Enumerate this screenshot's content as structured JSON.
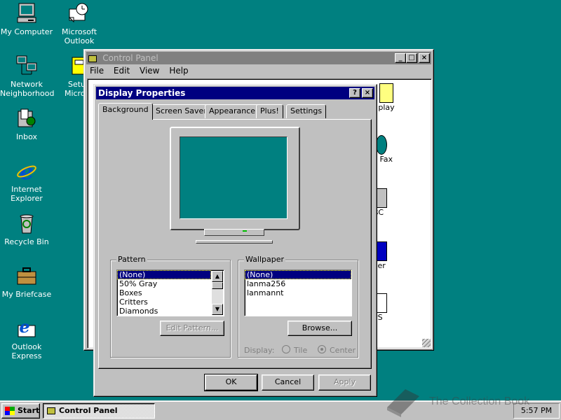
{
  "desktop": {
    "icons": [
      {
        "label": "My Computer"
      },
      {
        "label": "Microsoft\nOutlook"
      },
      {
        "label": "Network\nNeighborhood"
      },
      {
        "label": "Setup\nMicroso"
      },
      {
        "label": "Inbox"
      },
      {
        "label": "Internet\nExplorer"
      },
      {
        "label": "Recycle Bin"
      },
      {
        "label": "My Briefcase"
      },
      {
        "label": "Outlook\nExpress"
      }
    ]
  },
  "control_panel": {
    "title": "Control Panel",
    "menu": [
      "File",
      "Edit",
      "View",
      "Help"
    ],
    "partial_items": [
      "play",
      "nd Fax",
      "BC",
      "ver",
      "PS"
    ]
  },
  "display_properties": {
    "title": "Display Properties",
    "help_btn": "?",
    "close_btn": "×",
    "tabs": [
      "Background",
      "Screen Saver",
      "Appearance",
      "Plus!",
      "Settings"
    ],
    "pattern": {
      "legend": "Pattern",
      "items": [
        "(None)",
        "50% Gray",
        "Boxes",
        "Critters",
        "Diamonds"
      ],
      "selected": 0,
      "edit_button": "Edit Pattern..."
    },
    "wallpaper": {
      "legend": "Wallpaper",
      "items": [
        "(None)",
        "lanma256",
        "lanmannt"
      ],
      "selected": 0,
      "browse_button": "Browse...",
      "display_label": "Display:",
      "tile_label": "Tile",
      "center_label": "Center"
    },
    "buttons": {
      "ok": "OK",
      "cancel": "Cancel",
      "apply": "Apply"
    },
    "monitor_color": "#008080"
  },
  "taskbar": {
    "start_label": "Start",
    "task_label": "Control Panel",
    "clock": "5:57 PM"
  },
  "watermark": {
    "text": "The Collection Book"
  }
}
